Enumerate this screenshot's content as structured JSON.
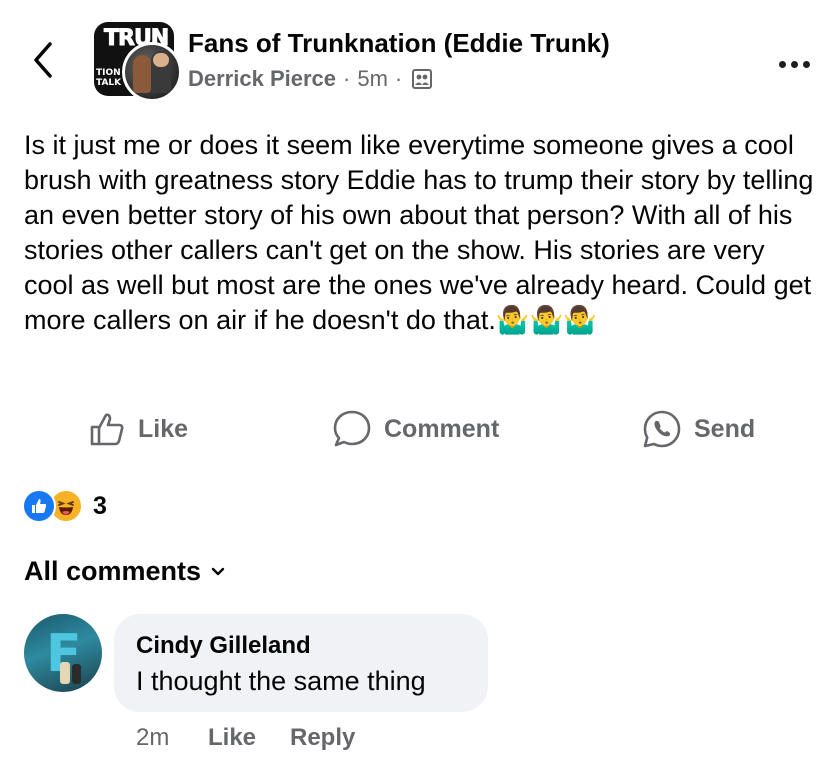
{
  "header": {
    "group_name": "Fans of Trunknation (Eddie Trunk)",
    "author": "Derrick Pierce",
    "time": "5m",
    "separator": "·",
    "group_logo_text": "TRUN",
    "group_logo_side": "TION TALK",
    "icons": {
      "back": "chevron-left-icon",
      "more": "more-dots-icon",
      "audience": "group-audience-icon"
    }
  },
  "post": {
    "text": "Is it just me or does it seem like everytime someone gives a cool brush with greatness story Eddie has to trump their story by telling an even better story of his own about that person? With all of his stories other callers can't get on the show. His stories are very cool as well but most are the ones we've already heard. Could get more callers on air if he doesn't do that.",
    "emojis": [
      "🤷‍♂️",
      "🤷‍♂️",
      "🤷‍♂️"
    ]
  },
  "actions": {
    "like": "Like",
    "comment": "Comment",
    "send": "Send"
  },
  "reactions": {
    "count": "3",
    "types": [
      "like",
      "haha"
    ]
  },
  "comments_header": {
    "label": "All comments"
  },
  "comments": [
    {
      "name": "Cindy Gilleland",
      "text": "I thought the same thing",
      "time": "2m",
      "like": "Like",
      "reply": "Reply"
    }
  ],
  "colors": {
    "text": "#050505",
    "secondary": "#65676b",
    "like_blue": "#1877f2",
    "haha_yellow": "#f7b125",
    "bubble": "#f0f2f5"
  }
}
